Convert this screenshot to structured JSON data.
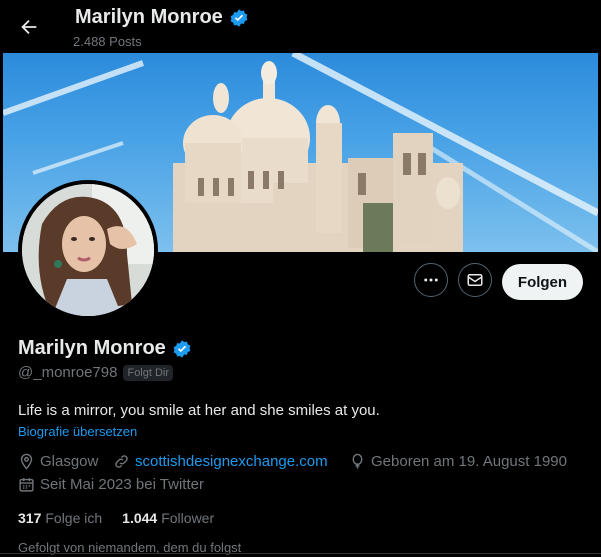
{
  "header": {
    "name": "Marilyn Monroe",
    "posts": "2.488 Posts"
  },
  "profile": {
    "name": "Marilyn Monroe",
    "handle": "@_monroe798",
    "follows_you": "Folgt Dir",
    "bio": "Life is a mirror, you smile at her and she smiles at you.",
    "translate_label": "Biografie übersetzen",
    "location": "Glasgow",
    "website": "scottishdesignexchange.com",
    "birthday": "Geboren am 19. August 1990",
    "joined": "Seit Mai 2023 bei Twitter",
    "following_count": "317",
    "following_label": "Folge ich",
    "followers_count": "1.044",
    "followers_label": "Follower",
    "followed_by": "Gefolgt von niemandem, dem du folgst"
  },
  "actions": {
    "follow_label": "Folgen"
  },
  "icons": {
    "back": "arrow-left-icon",
    "verified": "verified-badge-icon",
    "more": "more-icon",
    "message": "envelope-icon",
    "location": "location-pin-icon",
    "link": "link-icon",
    "birthday": "balloon-icon",
    "calendar": "calendar-icon"
  },
  "colors": {
    "background": "#000000",
    "accent": "#1d9bf0",
    "text_primary": "#e7e9ea",
    "text_secondary": "#71767b",
    "follow_button": "#eff3f4"
  }
}
